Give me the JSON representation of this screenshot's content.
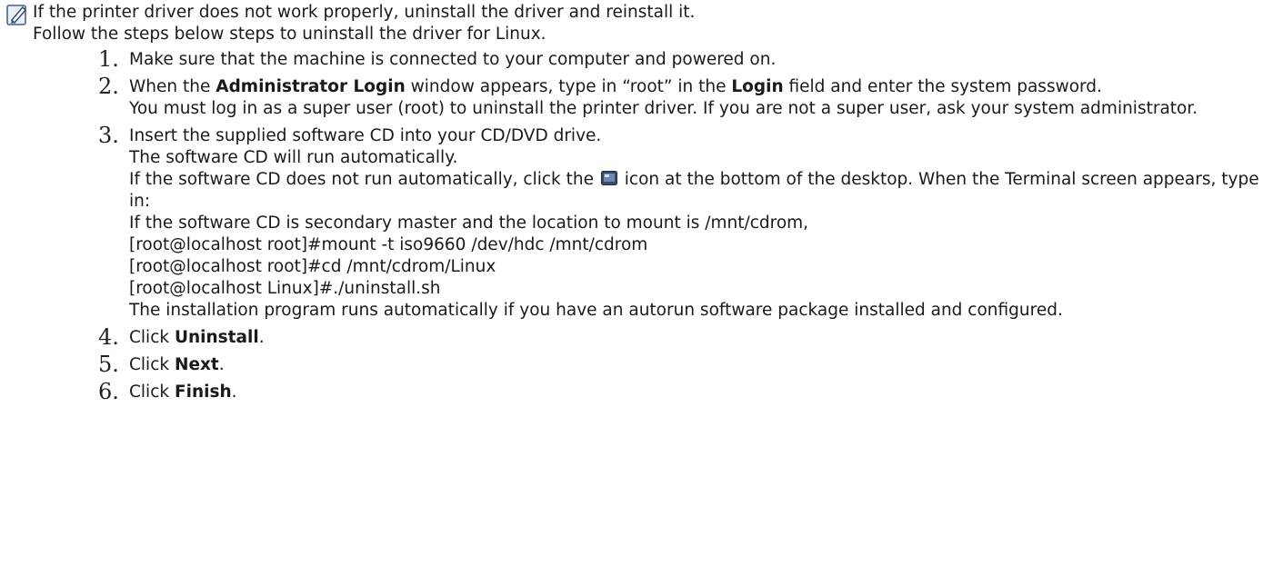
{
  "note": {
    "icon": "note-pencil-icon",
    "line1": "If the printer driver does not work properly, uninstall the driver and reinstall it.",
    "line2": "Follow the steps below steps to uninstall the driver for Linux."
  },
  "steps": [
    {
      "number": "1.",
      "text": "Make sure that the machine is connected to your computer and powered on."
    },
    {
      "number": "2.",
      "part1": "When the ",
      "bold1": "Administrator Login",
      "part2": " window appears, type in “root” in the ",
      "bold2": "Login",
      "part3": " field and enter the system password.",
      "note": "You must log in as a super user (root) to uninstall the printer driver. If you are not a super user, ask your system administrator."
    },
    {
      "number": "3.",
      "line1": "Insert the supplied software CD into your CD/DVD drive.",
      "line2": "The software CD will run automatically.",
      "line3a": "If the software CD does not run automatically, click the ",
      "line3_icon": "terminal-icon",
      "line3b": " icon at the bottom of the desktop. When the Terminal screen appears, type in:",
      "line4": "If the software CD is secondary master and the location to mount is /mnt/cdrom,",
      "cmd1": "[root@localhost root]#mount -t iso9660 /dev/hdc /mnt/cdrom",
      "cmd2": "[root@localhost root]#cd /mnt/cdrom/Linux",
      "cmd3": "[root@localhost Linux]#./uninstall.sh",
      "line5": "The installation program runs automatically if you have an autorun software package installed and configured."
    },
    {
      "number": "4.",
      "prefix": "Click ",
      "bold": "Uninstall",
      "suffix": "."
    },
    {
      "number": "5.",
      "prefix": "Click ",
      "bold": "Next",
      "suffix": "."
    },
    {
      "number": "6.",
      "prefix": "Click ",
      "bold": "Finish",
      "suffix": "."
    }
  ]
}
